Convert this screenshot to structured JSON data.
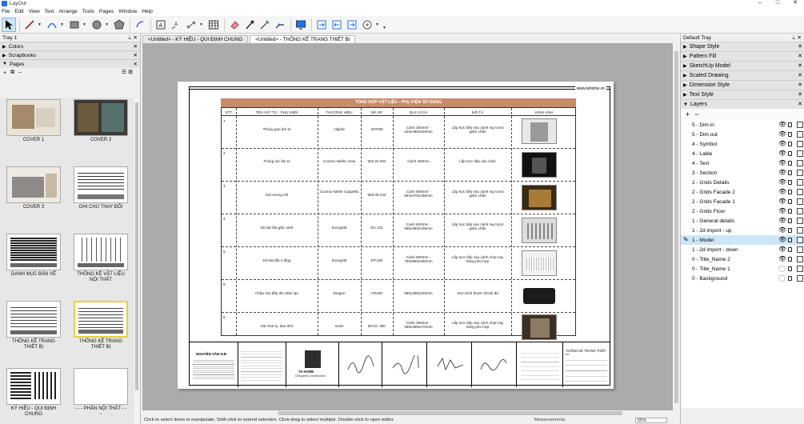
{
  "window": {
    "title": "LayOut"
  },
  "menu": [
    "File",
    "Edit",
    "View",
    "Text",
    "Arrange",
    "Tools",
    "Pages",
    "Window",
    "Help"
  ],
  "left_tray": {
    "title": "Tray 1",
    "panels": [
      "Colors",
      "Scrapbooks",
      "Pages"
    ],
    "pages_toolbar": {
      "add": "+",
      "duplicate": "⧉",
      "remove": "−"
    },
    "pages": [
      {
        "label": "COVER 1"
      },
      {
        "label": "COVER 2"
      },
      {
        "label": "COVER 3"
      },
      {
        "label": "GHI CHÚ THAY ĐỔI"
      },
      {
        "label": "DANH MỤC BẢN VẼ"
      },
      {
        "label": "THỐNG KÊ VẬT LIỆU NỘI THẤT"
      },
      {
        "label": "THỐNG KÊ TRANG THIẾT BỊ"
      },
      {
        "label": "THỐNG KÊ TRANG THIẾT BỊ"
      },
      {
        "label": "KÝ HIỆU - QUI ĐỊNH CHUNG"
      },
      {
        "label": "- - - PHẦN NỘI THẤT - - -"
      }
    ]
  },
  "doc_tabs": [
    {
      "label": "<Untitled> - KÝ HIỆU - QUI ĐỊNH CHUNG"
    },
    {
      "label": "<Untitled> - THỐNG KÊ TRANG THIẾT BỊ"
    }
  ],
  "sheet": {
    "website": "www.tahome.vn",
    "table_title": "TỔNG HỢP VẬT LIỆU - PHỤ KIỆN SỬ DỤNG",
    "headers": [
      "STT",
      "TÊN VẬT TƯ - PHỤ KIỆN",
      "THƯƠNG HIỆU",
      "MÃ SP",
      "QUI CÁCH",
      "MÔ TẢ",
      "HÌNH ẢNH"
    ],
    "rows": [
      {
        "stt": "7",
        "name": "Thùng gạo âm tủ",
        "brand": "Higold",
        "code": "207036",
        "spec": "Cánh 300mm - 240x480x320mm",
        "desc": "Lắp trực tiếp vào cánh ray trượt giảm chấn"
      },
      {
        "stt": "2",
        "name": "Thùng rác âm tủ",
        "brand": "Cucina Hafele Viola",
        "code": "502.24.002",
        "spec": "Cánh 400mm",
        "desc": "Lắp trực tiếp vào cánh"
      },
      {
        "stt": "3",
        "name": "Giá xoong nồi",
        "brand": "Cucina Hafele Cappella",
        "code": "559.08.224",
        "spec": "Cánh 900mm - 864x475x185mm",
        "desc": "Lắp trực tiếp vào cánh ray trượt giảm chấn"
      },
      {
        "stt": "4",
        "name": "Kệ bát đĩa gắn cánh",
        "brand": "Eurogold",
        "code": "EU.132",
        "spec": "Cánh 600mm - 565x450x195mm",
        "desc": "Lắp trực tiếp vào cánh ray trượt giảm chấn"
      },
      {
        "stt": "5",
        "name": "Kệ bát đĩa 2 tầng",
        "brand": "Eurogold",
        "code": "EP.180",
        "spec": "Cánh 800mm - 765x650x280mm",
        "desc": "Lắp trực tiếp vào cánh chọn tay nâng phù hợp"
      },
      {
        "stt": "6",
        "name": "Chậu rửa bếp đá nhân tạo",
        "brand": "Dragon",
        "code": "CR10D",
        "spec": "860x495x220mm",
        "desc": "Xem kích thước khoét đá"
      },
      {
        "stt": "5",
        "name": "Giá chai lọ, dao thớt",
        "brand": "Garis",
        "code": "BC02. 350",
        "spec": "Cánh 350mm - 285x485x470mm",
        "desc": "Lắp trực tiếp vào cánh chọn tay nâng phù hợp"
      }
    ],
    "title_block": {
      "designer_name": "NGUYỄN VĂN N.B",
      "company": "TA-HOME",
      "company_sub": "Designed Construction",
      "sheet_name": "THỐNG KÊ TRANG THIẾT BỊ"
    }
  },
  "right_tray": {
    "title": "Default Tray",
    "panels": [
      "Shape Style",
      "Pattern Fill",
      "SketchUp Model",
      "Scaled Drawing",
      "Dimension Style",
      "Text Style",
      "Layers"
    ],
    "layer_tools": {
      "add": "+",
      "remove": "−"
    },
    "layers": [
      {
        "name": "5 - Dim in",
        "visible": true
      },
      {
        "name": "5 - Dim out",
        "visible": true
      },
      {
        "name": "4 - Symbol",
        "visible": true
      },
      {
        "name": "4 - Lable",
        "visible": true
      },
      {
        "name": "4 - Text",
        "visible": true
      },
      {
        "name": "3 - Section",
        "visible": true
      },
      {
        "name": "2 - Grids Details",
        "visible": true
      },
      {
        "name": "2 - Grids Facade 2",
        "visible": true
      },
      {
        "name": "2 - Grids Facade 1",
        "visible": true
      },
      {
        "name": "2 - Grids Floor",
        "visible": true
      },
      {
        "name": "1 - General details",
        "visible": true
      },
      {
        "name": "1 - 2d import - up",
        "visible": true
      },
      {
        "name": "1 - Model",
        "visible": true,
        "selected": true
      },
      {
        "name": "1 - 2d import - down",
        "visible": true
      },
      {
        "name": "0 - Title_Name 2",
        "visible": true
      },
      {
        "name": "0 - Title_Name 1",
        "visible": false
      },
      {
        "name": "0 - Background",
        "visible": false
      }
    ]
  },
  "status": {
    "hint": "Click to select items to manipulate. Shift-click to extend selection. Click-drag to select multiple. Double-click to open editor.",
    "measurements": "Measurements",
    "zoom": "55%"
  },
  "colors": {
    "accent_select": "#cde6f7",
    "table_title_bg": "#c98a6a",
    "selected_page_border": "#e3d33a"
  }
}
